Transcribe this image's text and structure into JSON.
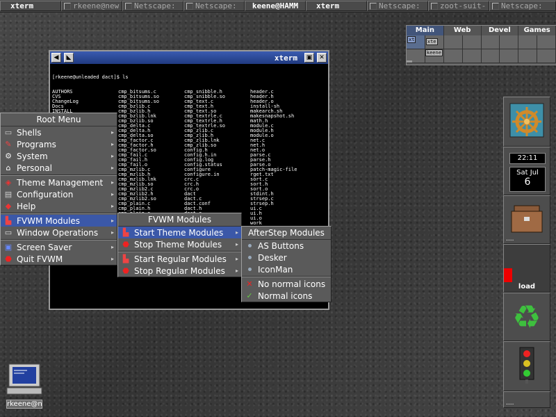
{
  "taskbar": [
    {
      "label": "xterm",
      "active": true
    },
    {
      "label": "rkeene@new",
      "active": false
    },
    {
      "label": "Netscape:",
      "active": false
    },
    {
      "label": "Netscape:",
      "active": false
    },
    {
      "label": "keene@HAMM",
      "active": true
    },
    {
      "label": "xterm",
      "active": true
    },
    {
      "label": "Netscape:",
      "active": false
    },
    {
      "label": "zoot-suit-",
      "active": false
    },
    {
      "label": "Netscape:",
      "active": false
    }
  ],
  "pager": {
    "desks": [
      "Main",
      "Web",
      "Devel",
      "Games"
    ],
    "mini_windows": [
      "xt",
      "xte",
      "keene"
    ]
  },
  "xterm": {
    "title": "xterm",
    "prompt": "[rkeene@unleaded dact]$ ls",
    "columns": [
      [
        "AUTHORS",
        "CVS",
        "ChangeLog",
        "Docs",
        "INSTALL",
        "LICENSE",
        "Makefile",
        "Makefile.dep",
        "Makefile.in",
        "README",
        "TODO",
        "acconfig.h",
        "aclocal.m4",
        "buffer.c",
        "buffer.h",
        "buffer.o",
        "cmp_bitsums.c",
        "cmp_bitsums.so",
        "cmp_bzlib.c",
        "cmp_bzlib.lnk",
        "cmp_bzlib.so",
        "cmp_bzlib2.c",
        "cmp_bzlib2.h",
        "cmp_bzlib2.so",
        "cmp_mzlib.c",
        "cmp_mzlib.h",
        "cmp_mzlib.so"
      ],
      [
        "cmp_bitsums.c",
        "cmp_bitsums.so",
        "cmp_bitsums.so",
        "cmp_bzlib.c",
        "cmp_bzlib.h",
        "cmp_bzlib.lnk",
        "cmp_bzlib.so",
        "cmp_delta.c",
        "cmp_delta.h",
        "cmp_delta.so",
        "cmp_factor.c",
        "cmp_factor.h",
        "cmp_factor.so",
        "cmp_fail.c",
        "cmp_fail.h",
        "cmp_fail.o",
        "cmp_mzlib.c",
        "cmp_mzlib.h",
        "cmp_mzlib.lnk",
        "cmp_mzlib.so",
        "cmp_mzlib2.c",
        "cmp_mzlib2.h",
        "cmp_mzlib2.so",
        "cmp_plain.c",
        "cmp_plain.h",
        "cmp_plain.o",
        "cmp_rle.c",
        "cmp_rle.h"
      ],
      [
        "cmp_snibble.h",
        "cmp_snibble.so",
        "cmp_text.c",
        "cmp_text.h",
        "cmp_text.so",
        "cmp_textrle.c",
        "cmp_textrle.h",
        "cmp_textrle.so",
        "cmp_zlib.c",
        "cmp_zlib.h",
        "cmp_zlib.lnk",
        "cmp_zlib.so",
        "config.h",
        "config.h.in",
        "config.log",
        "config.status",
        "configure",
        "configure.in",
        "crc.c",
        "crc.h",
        "crc.o",
        "dact",
        "dact.c",
        "dact.conf",
        "dact.h",
        "dact.o",
        "dendian.c",
        "dendian.h",
        "dendian.o"
      ],
      [
        "header.c",
        "header.h",
        "header.o",
        "install-sh",
        "makearch.sh",
        "makesnapshot.sh",
        "math.h",
        "module.c",
        "module.h",
        "module.o",
        "net.c",
        "net.h",
        "net.o",
        "parse.c",
        "parse.h",
        "parse.o",
        "patch-magic-file",
        "rget.txt",
        "sort.c",
        "sort.h",
        "sort.o",
        "stdint.h",
        "strsep.c",
        "strsep.h",
        "ui.c",
        "ui.h",
        "ui.o",
        "work"
      ]
    ]
  },
  "root_menu": {
    "title": "Root Menu",
    "groups": [
      [
        "Shells",
        "Programs",
        "System",
        "Personal"
      ],
      [
        "Theme Management",
        "Configuration",
        "Help"
      ],
      [
        "FVWM Modules",
        "Window Operations"
      ],
      [
        "Screen Saver",
        "Quit FVWM"
      ]
    ]
  },
  "fvwm_modules_menu": {
    "title": "FVWM Modules",
    "items": [
      "Start Theme Modules",
      "Stop Theme Modules",
      "Start Regular Modules",
      "Stop Regular Modules"
    ]
  },
  "afterstep_menu": {
    "title": "AfterStep Modules",
    "items": [
      "AS Buttons",
      "Desker",
      "IconMan"
    ],
    "extra": [
      "No normal icons",
      "Normal icons"
    ]
  },
  "wharf": {
    "clock": "22:11",
    "day": "Sat Jul",
    "date": "6",
    "load_label": "load",
    "dots": "...."
  },
  "desktop_icon": {
    "label": "rkeene@n"
  }
}
